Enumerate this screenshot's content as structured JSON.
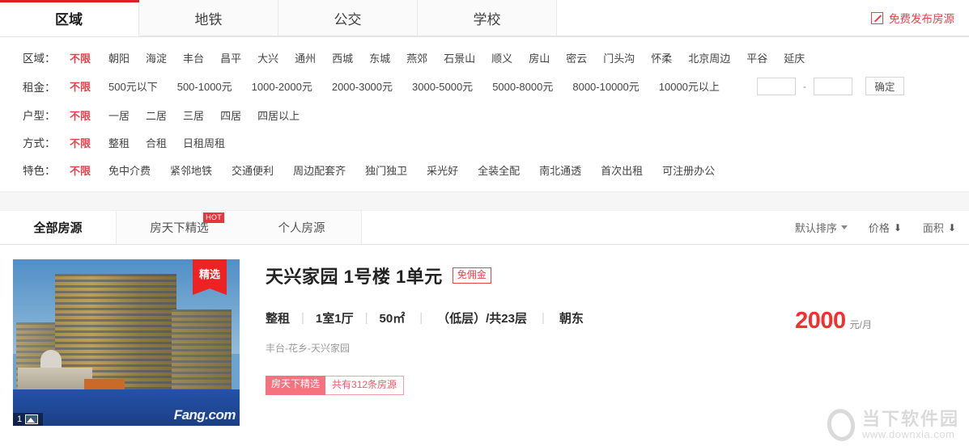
{
  "top_tabs": [
    {
      "label": "区域",
      "active": true
    },
    {
      "label": "地铁",
      "active": false
    },
    {
      "label": "公交",
      "active": false
    },
    {
      "label": "学校",
      "active": false
    }
  ],
  "publish": {
    "label": "免费发布房源",
    "icon": "pencil-icon",
    "color": "#e8424b"
  },
  "filters": [
    {
      "label": "区域：",
      "unlimited": "不限",
      "options": [
        "朝阳",
        "海淀",
        "丰台",
        "昌平",
        "大兴",
        "通州",
        "西城",
        "东城",
        "燕郊",
        "石景山",
        "顺义",
        "房山",
        "密云",
        "门头沟",
        "怀柔",
        "北京周边",
        "平谷",
        "延庆"
      ]
    },
    {
      "label": "租金：",
      "unlimited": "不限",
      "options": [
        "500元以下",
        "500-1000元",
        "1000-2000元",
        "2000-3000元",
        "3000-5000元",
        "5000-8000元",
        "8000-10000元",
        "10000元以上"
      ],
      "range": {
        "min_value": "",
        "max_value": "",
        "min_placeholder": "",
        "max_placeholder": "",
        "dash": "-",
        "submit": "确定"
      }
    },
    {
      "label": "户型：",
      "unlimited": "不限",
      "options": [
        "一居",
        "二居",
        "三居",
        "四居",
        "四居以上"
      ]
    },
    {
      "label": "方式：",
      "unlimited": "不限",
      "options": [
        "整租",
        "合租",
        "日租周租"
      ]
    },
    {
      "label": "特色：",
      "unlimited": "不限",
      "options": [
        "免中介费",
        "紧邻地铁",
        "交通便利",
        "周边配套齐",
        "独门独卫",
        "采光好",
        "全装全配",
        "南北通透",
        "首次出租",
        "可注册办公"
      ]
    }
  ],
  "list_tabs": [
    {
      "label": "全部房源",
      "active": true,
      "badge": ""
    },
    {
      "label": "房天下精选",
      "active": false,
      "badge": "HOT"
    },
    {
      "label": "个人房源",
      "active": false,
      "badge": ""
    }
  ],
  "sorts": [
    {
      "label": "默认排序",
      "icon": "chevron-down-icon"
    },
    {
      "label": "价格",
      "icon": "arrow-down-icon"
    },
    {
      "label": "面积",
      "icon": "arrow-down-icon"
    }
  ],
  "listing": {
    "thumb": {
      "ribbon": "精选",
      "photo_count": "1",
      "photo_icon": "photo-icon",
      "source_watermark": "Fang.com"
    },
    "title": "天兴家园 1号楼 1单元",
    "nofee_tag": "免佣金",
    "specs": [
      "整租",
      "1室1厅",
      "50㎡",
      "（低层）/共23层",
      "朝东"
    ],
    "address": "丰台-花乡-天兴家园",
    "badge_selected": "房天下精选",
    "badge_count": "共有312条房源",
    "price": "2000",
    "price_unit": "元/月",
    "price_color": "#f23030"
  },
  "watermark": {
    "title": "当下软件园",
    "url": "www.downxia.com"
  }
}
